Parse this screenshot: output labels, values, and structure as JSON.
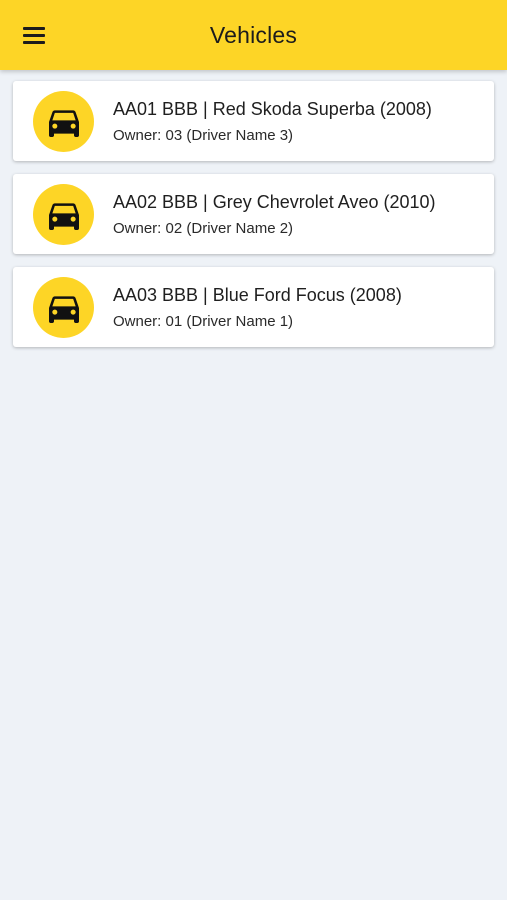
{
  "app_bar": {
    "title": "Vehicles",
    "menu_icon": "hamburger-menu-icon",
    "background": "#fdd526"
  },
  "vehicles": [
    {
      "title": "AA01 BBB | Red Skoda Superba (2008)",
      "owner": "Owner: 03 (Driver Name 3)",
      "icon": "car-icon"
    },
    {
      "title": "AA02 BBB | Grey Chevrolet Aveo (2010)",
      "owner": "Owner: 02 (Driver Name 2)",
      "icon": "car-icon"
    },
    {
      "title": "AA03 BBB | Blue Ford Focus (2008)",
      "owner": "Owner: 01 (Driver Name 1)",
      "icon": "car-icon"
    }
  ],
  "colors": {
    "accent": "#fdd526",
    "page_background": "#eef2f7",
    "card_background": "#ffffff"
  }
}
